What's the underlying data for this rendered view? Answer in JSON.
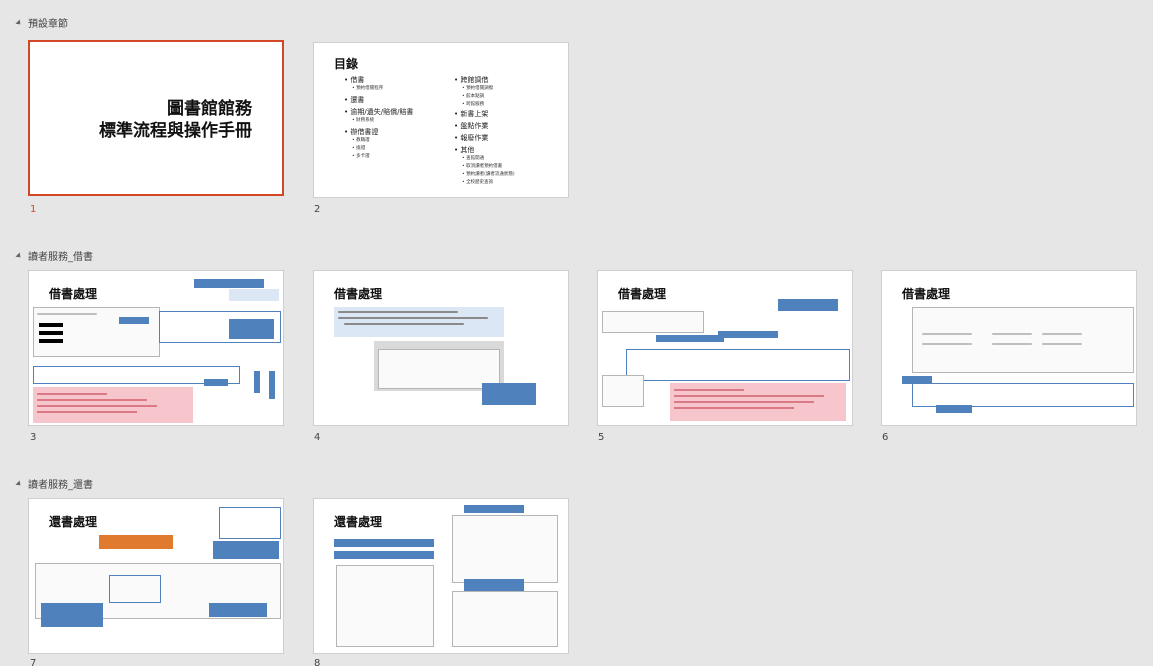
{
  "sections": [
    {
      "label": "預設章節"
    },
    {
      "label": "讀者服務_借書"
    },
    {
      "label": "讀者服務_還書"
    }
  ],
  "slides": [
    {
      "number": "1",
      "title_line1": "圖書館館務",
      "title_line2": "標準流程與操作手冊"
    },
    {
      "number": "2",
      "title": "目錄",
      "col1": [
        "借書",
        "還書",
        "逾期/遺失/賠償/賠書",
        "辦借書證"
      ],
      "col1_sub": {
        "0": [
          "預約借閱程序"
        ],
        "2": [
          "財務系統"
        ],
        "3": [
          "教職證",
          "換證",
          "多卡證"
        ]
      },
      "col2": [
        "跨館調借",
        "新書上架",
        "盤點作業",
        "報廢作業",
        "其他"
      ],
      "col2_sub": {
        "0": [
          "預約借閱調撥",
          "館本點調",
          "跨館服務"
        ],
        "4": [
          "查館開通",
          "取消讀者預約借書",
          "預約讀者(讀者流通狀態)",
          "全校歷史查詢"
        ]
      }
    },
    {
      "number": "3",
      "title": "借書處理"
    },
    {
      "number": "4",
      "title": "借書處理"
    },
    {
      "number": "5",
      "title": "借書處理"
    },
    {
      "number": "6",
      "title": "借書處理"
    },
    {
      "number": "7",
      "title": "還書處理"
    },
    {
      "number": "8",
      "title": "還書處理"
    }
  ]
}
